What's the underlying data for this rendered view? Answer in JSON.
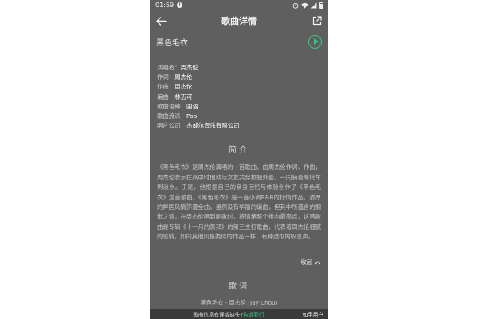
{
  "status_bar": {
    "time": "01:59"
  },
  "header": {
    "title": "歌曲详情"
  },
  "song": {
    "name": "黑色毛衣"
  },
  "meta": [
    {
      "key": "演唱者：",
      "value": "周杰伦"
    },
    {
      "key": "作词：",
      "value": "周杰伦"
    },
    {
      "key": "作曲：",
      "value": "周杰伦"
    },
    {
      "key": "编曲：",
      "value": "林迈可"
    },
    {
      "key": "歌曲语种：",
      "value": "国语"
    },
    {
      "key": "歌曲流派：",
      "value": "Pop"
    },
    {
      "key": "唱片公司：",
      "value": "杰威尔音乐有限公司"
    }
  ],
  "intro": {
    "title": "简介",
    "text": "《黑色毛衣》是周杰伦演唱的一首歌曲，由周杰伦作词、作曲，周杰伦表示在高中时他就与女友共穿校服外套，一同骑着摩托车到淡水。于是，他根据自己的亲身回忆与体验创作了《黑色毛衣》这首歌曲。《黑色毛衣》是一首小调R&B的抒情作品，浓厚的异国风情弥漫全曲，虽然没有华丽的编曲，但其中所蕴含的惆怅之情，在周杰伦唱到副歌时，将情绪整个推向最高点，这首歌曲是专辑《十一月的萧邦》的第三主打歌曲，代表着周杰伦细腻的感情，如同其他风格类似的作品一样，有种透彻的叹息声。",
    "collapse_label": "收起"
  },
  "lyrics": {
    "title": "歌词",
    "first_line": "黑色毛衣 - 周杰伦 (Jay Chou)"
  },
  "bottom_bar": {
    "message": "歌曲信息有误或缺失?",
    "link": "告诉我们",
    "right": "如手用户"
  },
  "colors": {
    "background": "#5f5f5f",
    "accent": "#3bc785"
  }
}
